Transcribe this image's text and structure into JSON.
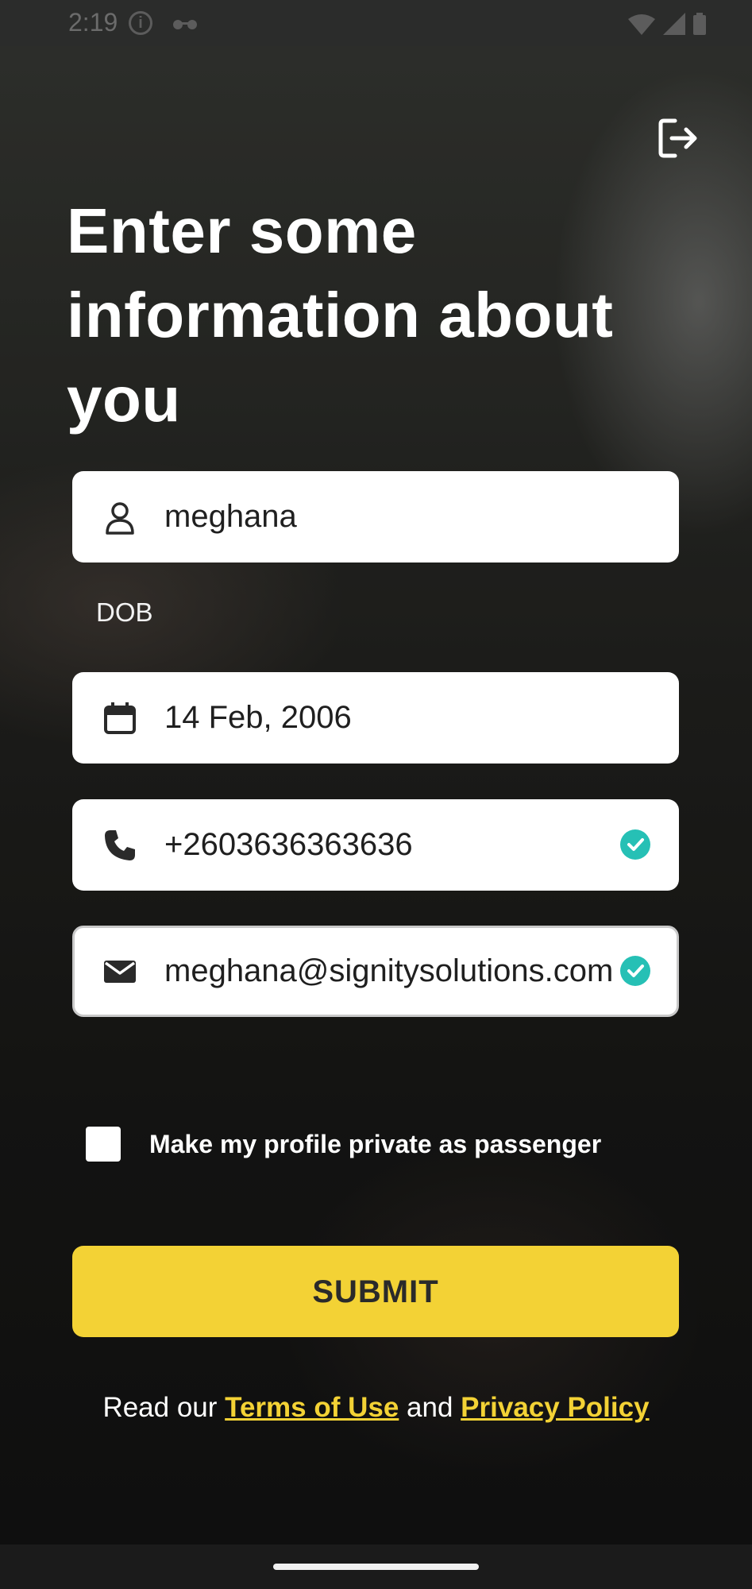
{
  "status_bar": {
    "time": "2:19"
  },
  "header": {
    "title": "Enter some information about you",
    "exit_icon": "logout-icon"
  },
  "form": {
    "name": {
      "value": "meghana",
      "icon": "person-icon"
    },
    "dob_label": "DOB",
    "dob": {
      "value": "14 Feb, 2006",
      "icon": "calendar-icon"
    },
    "phone": {
      "value": "+2603636363636",
      "icon": "phone-icon",
      "verified": true
    },
    "email": {
      "value": "meghana@signitysolutions.com",
      "icon": "mail-icon",
      "verified": true
    },
    "private_checkbox": {
      "label": "Make my profile private as passenger",
      "checked": false
    },
    "submit_label": "SUBMIT"
  },
  "footer": {
    "prefix": "Read our ",
    "terms": "Terms of Use",
    "middle": " and ",
    "privacy": "Privacy Policy"
  },
  "colors": {
    "accent": "#f3d235",
    "check": "#26c0b5"
  }
}
